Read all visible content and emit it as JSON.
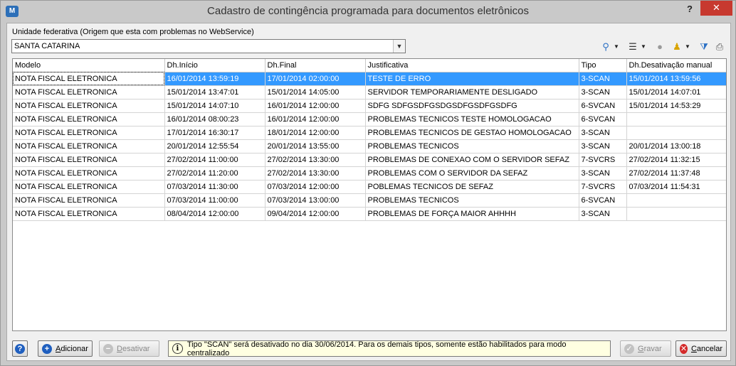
{
  "window": {
    "title": "Cadastro de contingência programada para documentos eletrônicos",
    "help_label": "?",
    "close_label": "✕",
    "app_icon_label": "M"
  },
  "uf": {
    "label": "Unidade federativa (Origem que esta com problemas no WebService)",
    "selected": "SANTA CATARINA"
  },
  "toolbar": {
    "icons": [
      "hierarchy-icon",
      "list-options-icon",
      "record-icon",
      "stamp-icon",
      "filter-icon",
      "print-icon"
    ]
  },
  "table": {
    "columns": [
      "Modelo",
      "Dh.Início",
      "Dh.Final",
      "Justificativa",
      "Tipo",
      "Dh.Desativação manual"
    ],
    "selected_row": 0,
    "rows": [
      [
        "NOTA FISCAL ELETRONICA",
        "16/01/2014 13:59:19",
        "17/01/2014 02:00:00",
        "TESTE DE ERRO",
        "3-SCAN",
        "15/01/2014 13:59:56"
      ],
      [
        "NOTA FISCAL ELETRONICA",
        "15/01/2014 13:47:01",
        "15/01/2014 14:05:00",
        "SERVIDOR TEMPORARIAMENTE DESLIGADO",
        "3-SCAN",
        "15/01/2014 14:07:01"
      ],
      [
        "NOTA FISCAL ELETRONICA",
        "15/01/2014 14:07:10",
        "16/01/2014 12:00:00",
        "SDFG SDFGSDFGSDGSDFGSDFGSDFG",
        "6-SVCAN",
        "15/01/2014 14:53:29"
      ],
      [
        "NOTA FISCAL ELETRONICA",
        "16/01/2014 08:00:23",
        "16/01/2014 12:00:00",
        "PROBLEMAS TECNICOS TESTE HOMOLOGACAO",
        "6-SVCAN",
        ""
      ],
      [
        "NOTA FISCAL ELETRONICA",
        "17/01/2014 16:30:17",
        "18/01/2014 12:00:00",
        "PROBLEMAS TECNICOS DE GESTAO HOMOLOGACAO",
        "3-SCAN",
        ""
      ],
      [
        "NOTA FISCAL ELETRONICA",
        "20/01/2014 12:55:54",
        "20/01/2014 13:55:00",
        "PROBLEMAS TECNICOS",
        "3-SCAN",
        "20/01/2014 13:00:18"
      ],
      [
        "NOTA FISCAL ELETRONICA",
        "27/02/2014 11:00:00",
        "27/02/2014 13:30:00",
        "PROBLEMAS DE CONEXAO COM O SERVIDOR SEFAZ",
        "7-SVCRS",
        "27/02/2014 11:32:15"
      ],
      [
        "NOTA FISCAL ELETRONICA",
        "27/02/2014 11:20:00",
        "27/02/2014 13:30:00",
        "PROBLEMAS COM O SERVIDOR DA SEFAZ",
        "3-SCAN",
        "27/02/2014 11:37:48"
      ],
      [
        "NOTA FISCAL ELETRONICA",
        "07/03/2014 11:30:00",
        "07/03/2014 12:00:00",
        "POBLEMAS TECNICOS DE SEFAZ",
        "7-SVCRS",
        "07/03/2014 11:54:31"
      ],
      [
        "NOTA FISCAL ELETRONICA",
        "07/03/2014 11:00:00",
        "07/03/2014 13:00:00",
        "PROBLEMAS TECNICOS",
        "6-SVCAN",
        ""
      ],
      [
        "NOTA FISCAL ELETRONICA",
        "08/04/2014 12:00:00",
        "09/04/2014 12:00:00",
        "PROBLEMAS DE FORÇA MAIOR AHHHH",
        "3-SCAN",
        ""
      ]
    ]
  },
  "buttons": {
    "help": "?",
    "add_first": "A",
    "add_rest": "dicionar",
    "deactivate_first": "D",
    "deactivate_rest": "esativar",
    "save_first": "G",
    "save_rest": "ravar",
    "cancel_first": "C",
    "cancel_rest": "ancelar"
  },
  "info": {
    "icon_letter": "i",
    "text": "Tipo \"SCAN\" será desativado no dia 30/06/2014. Para os demais tipos, somente estão habilitados para modo centralizado"
  },
  "colors": {
    "selection": "#3399ff",
    "close_button": "#c7392f",
    "info_background": "#ffffe1"
  }
}
